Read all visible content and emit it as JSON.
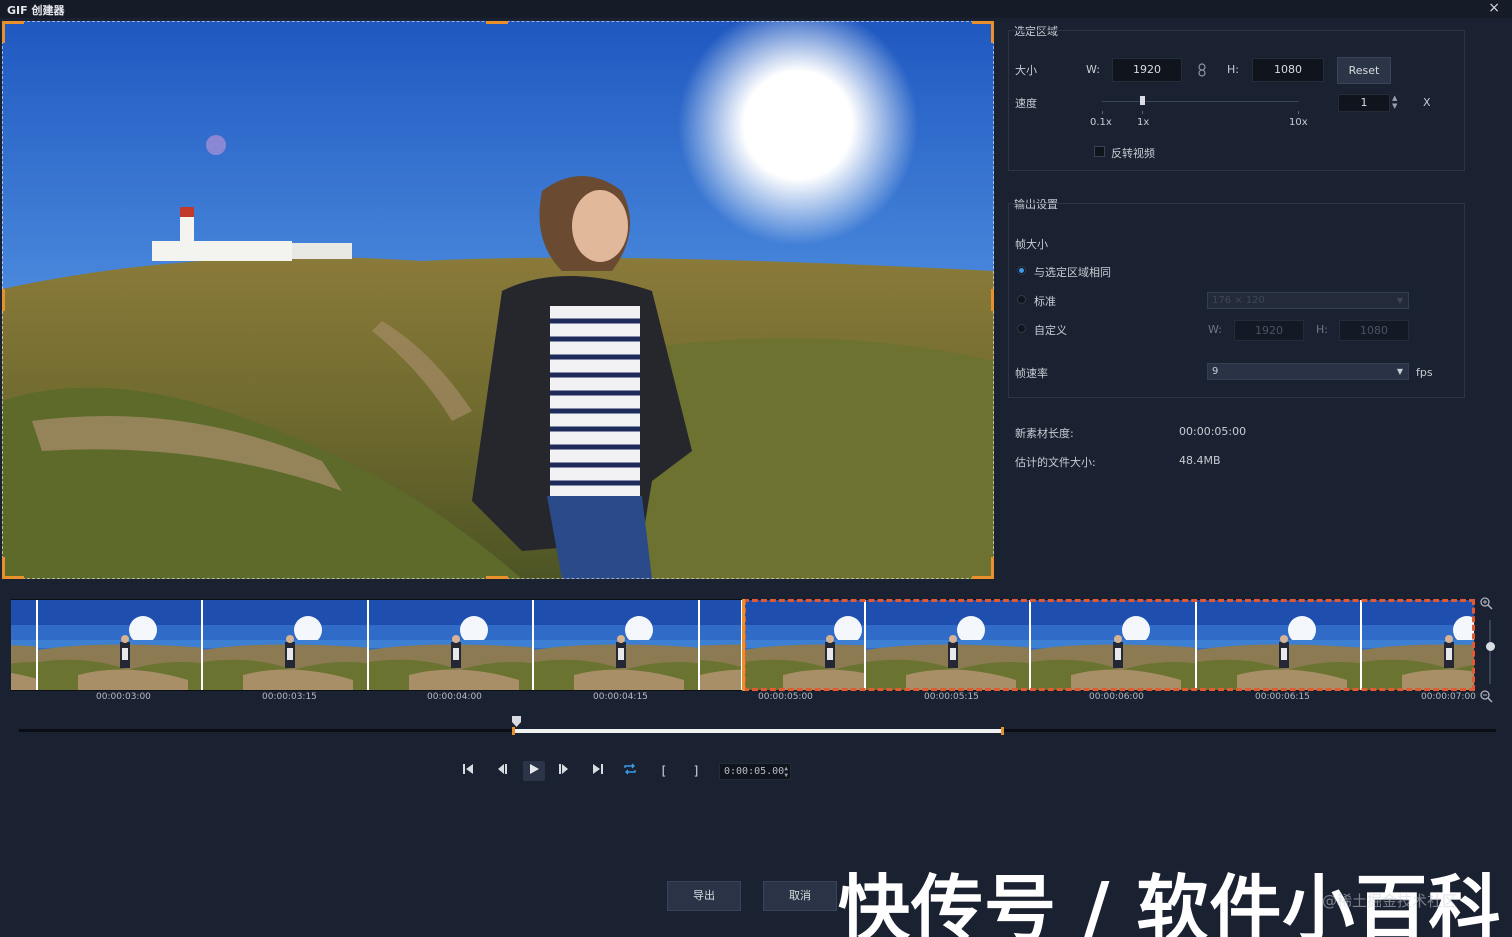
{
  "window": {
    "title": "GIF 创建器",
    "close": "×"
  },
  "selection": {
    "section_title": "选定区域",
    "size_label": "大小",
    "w_label": "W:",
    "w_value": "1920",
    "h_label": "H:",
    "h_value": "1080",
    "link_icon": "chain-link-icon",
    "reset_label": "Reset",
    "speed_label": "速度",
    "speed_ticks": [
      "0.1x",
      "1x",
      "10x"
    ],
    "speed_value": "1",
    "speed_unit": "X",
    "speed_level": 1,
    "reverse_label": "反转视频",
    "reverse_checked": false
  },
  "output": {
    "section_title": "输出设置",
    "frame_size_label": "帧大小",
    "options": [
      {
        "label": "与选定区域相同",
        "selected": true
      },
      {
        "label": "标准",
        "selected": false
      },
      {
        "label": "自定义",
        "selected": false
      }
    ],
    "standard_value": "176 × 120",
    "custom_w_label": "W:",
    "custom_w_value": "1920",
    "custom_h_label": "H:",
    "custom_h_value": "1080",
    "framerate_label": "帧速率",
    "framerate_value": "9",
    "framerate_unit": "fps"
  },
  "info": {
    "clip_length_label": "新素材长度:",
    "clip_length_value": "00:00:05:00",
    "file_size_label": "估计的文件大小:",
    "file_size_value": "48.4MB"
  },
  "timeline": {
    "timecodes": [
      "00:00:03:00",
      "00:00:03:15",
      "00:00:04:00",
      "00:00:04:15",
      "00:00:05:00",
      "00:00:05:15",
      "00:00:06:00",
      "00:00:06:15",
      "00:00:07:00"
    ],
    "current_time": "0:00:05.00"
  },
  "transport": {
    "icons": [
      "skip-to-start-icon",
      "step-back-icon",
      "play-icon",
      "step-forward-icon",
      "skip-to-end-icon",
      "loop-icon",
      "mark-in-icon",
      "mark-out-icon"
    ]
  },
  "buttons": {
    "export": "导出",
    "cancel": "取消"
  },
  "watermark": {
    "main": "快传号 / 软件小百科",
    "sub": "@稀土掘金技术社区"
  },
  "colors": {
    "accent": "#3a9be8",
    "selection": "#e7902c",
    "background": "#1a2130"
  }
}
